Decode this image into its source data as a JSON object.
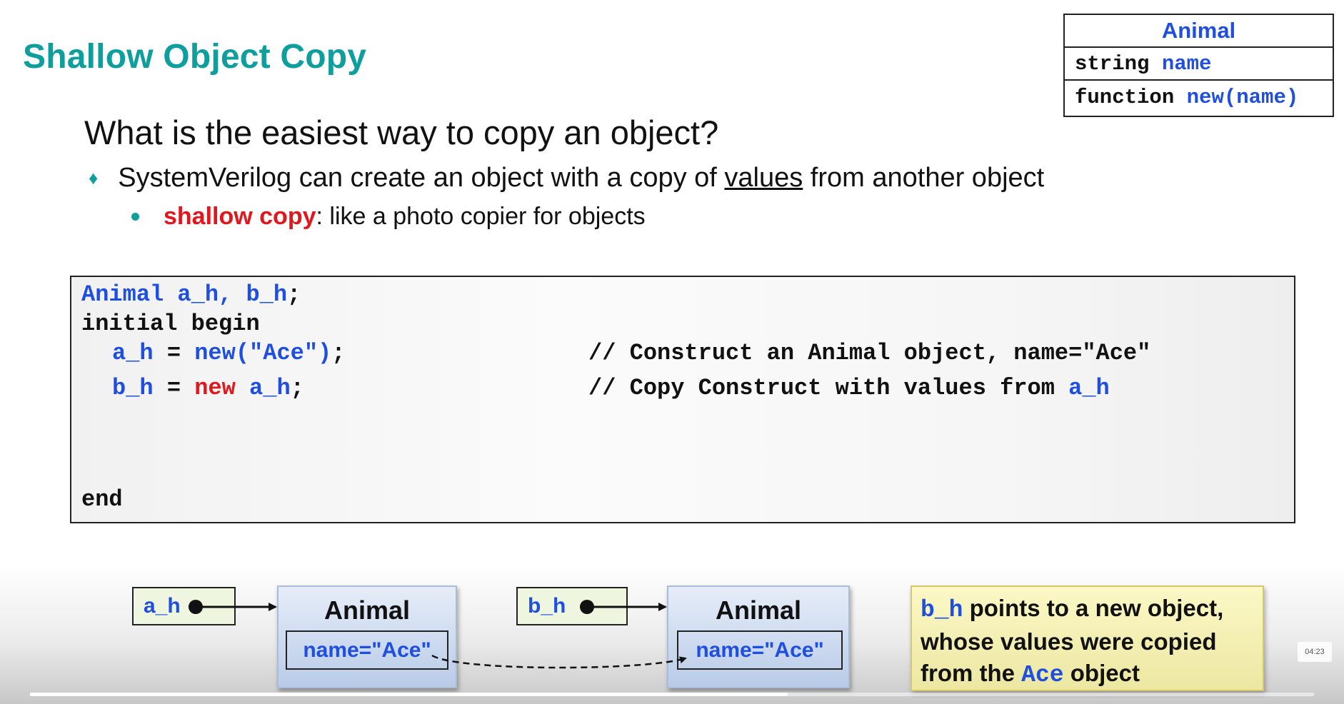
{
  "slide": {
    "title": "Shallow Object Copy",
    "question": "What is the easiest way to copy an object?",
    "bullet1": {
      "before": "SystemVerilog can create an object with a copy of ",
      "underlined": "values",
      "after": " from another object"
    },
    "bullet2": {
      "highlight": "shallow copy",
      "rest": ": like a photo copier for objects"
    }
  },
  "class_box": {
    "name": "Animal",
    "field_type": "string",
    "field_name": "name",
    "method_kw": "function",
    "method_sig": "new(name)"
  },
  "code": {
    "l1_type": "Animal",
    "l1_vars": "a_h, b_h",
    "l1_sep": ";",
    "l2": "initial begin",
    "l3_var": "a_h",
    "l3_eq": " = ",
    "l3_call": "new(\"Ace\")",
    "l3_end": ";",
    "l3_comment": "// Construct an Animal object, name=\"Ace\"",
    "l4_var": "b_h",
    "l4_eq": " = ",
    "l4_new": "new",
    "l4_src": " a_h",
    "l4_end": ";",
    "l4_comment_a": "// Copy Construct with values from ",
    "l4_comment_b": "a_h",
    "l5": "end"
  },
  "diagram": {
    "handle_a": "a_h",
    "handle_b": "b_h",
    "object_a_title": "Animal",
    "object_a_field": "name=\"Ace\"",
    "object_b_title": "Animal",
    "object_b_field": "name=\"Ace\""
  },
  "note": {
    "var": "b_h",
    "line1_rest": " points to a new object,",
    "line2": "whose values were copied",
    "line3_pre": "from the ",
    "line3_mono": "Ace",
    "line3_post": " object"
  },
  "player": {
    "timestamp": "04:23",
    "progress": 0.59
  },
  "colors": {
    "title": "#0f9e9e",
    "keyword_blue": "#1f4fe0",
    "keyword_red": "#e2171b"
  }
}
